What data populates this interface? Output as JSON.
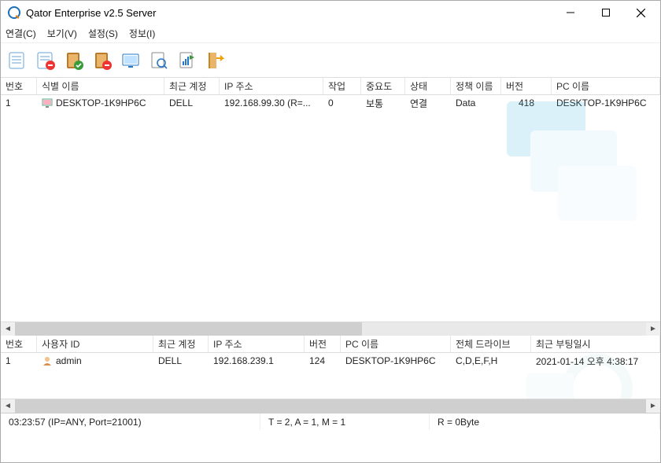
{
  "title": "Qator Enterprise v2.5 Server",
  "menu": {
    "connect": "연결(C)",
    "view": "보기(V)",
    "settings": "설정(S)",
    "info": "정보(I)"
  },
  "top_grid": {
    "headers": {
      "no": "번호",
      "id_name": "식별 이름",
      "recent_acct": "최근 계정",
      "ip": "IP 주소",
      "task": "작업",
      "importance": "중요도",
      "status": "상태",
      "policy": "정책 이름",
      "version": "버전",
      "pc_name": "PC 이름"
    },
    "rows": [
      {
        "no": "1",
        "id_name": "DESKTOP-1K9HP6C",
        "recent_acct": "DELL",
        "ip": "192.168.99.30 (R=...",
        "task": "0",
        "importance": "보통",
        "status": "연결",
        "policy": "Data",
        "version": "418",
        "pc_name": "DESKTOP-1K9HP6C"
      }
    ]
  },
  "bottom_grid": {
    "headers": {
      "no": "번호",
      "user_id": "사용자 ID",
      "recent_acct": "최근 계정",
      "ip": "IP 주소",
      "version": "버전",
      "pc_name": "PC 이름",
      "drives": "전체 드라이브",
      "last_boot": "최근 부팅일시"
    },
    "rows": [
      {
        "no": "1",
        "user_id": "admin",
        "recent_acct": "DELL",
        "ip": "192.168.239.1",
        "version": "124",
        "pc_name": "DESKTOP-1K9HP6C",
        "drives": "C,D,E,F,H",
        "last_boot": "2021-01-14 오후 4:38:17"
      }
    ]
  },
  "status": {
    "left": "03:23:57 (IP=ANY, Port=21001)",
    "mid": "T = 2, A = 1, M = 1",
    "right": "R = 0Byte"
  }
}
